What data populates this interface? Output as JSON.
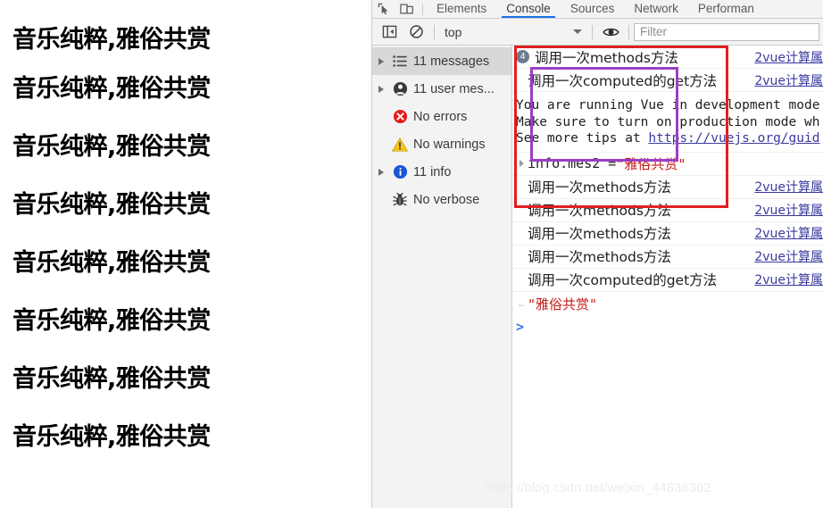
{
  "page": {
    "headings": [
      "音乐纯粹,雅俗共赏",
      "音乐纯粹,雅俗共赏",
      "音乐纯粹,雅俗共赏",
      "音乐纯粹,雅俗共赏",
      "音乐纯粹,雅俗共赏",
      "音乐纯粹,雅俗共赏",
      "音乐纯粹,雅俗共赏",
      "音乐纯粹,雅俗共赏"
    ]
  },
  "devtools": {
    "tabs": [
      {
        "label": "Elements",
        "active": false
      },
      {
        "label": "Console",
        "active": true
      },
      {
        "label": "Sources",
        "active": false
      },
      {
        "label": "Network",
        "active": false
      },
      {
        "label": "Performan",
        "active": false
      }
    ],
    "toolbar_icons": [
      {
        "name": "inspect-element-icon"
      },
      {
        "name": "device-toolbar-icon"
      }
    ],
    "filterbar": {
      "sidebar_toggle_icon": "show-console-sidebar-icon",
      "clear_console_icon": "clear-console-icon",
      "context": "top",
      "live_expression_icon": "eye-icon",
      "filter_placeholder": "Filter",
      "filter_value": ""
    },
    "sidebar": {
      "items": [
        {
          "label": "11 messages",
          "icon": "list-icon",
          "expandable": true,
          "selected": true
        },
        {
          "label": "11 user mes...",
          "icon": "user-icon",
          "expandable": true,
          "selected": false
        },
        {
          "label": "No errors",
          "icon": "error-icon",
          "expandable": false,
          "selected": false
        },
        {
          "label": "No warnings",
          "icon": "warning-icon",
          "expandable": false,
          "selected": false
        },
        {
          "label": "11 info",
          "icon": "info-icon",
          "expandable": true,
          "selected": false
        },
        {
          "label": "No verbose",
          "icon": "bug-icon",
          "expandable": false,
          "selected": false
        }
      ]
    },
    "messages": {
      "top_rows": [
        {
          "badge": "4",
          "text": "调用一次methods方法",
          "source": "2vue计算属"
        },
        {
          "badge": "",
          "text": "调用一次computed的get方法",
          "source": "2vue计算属"
        }
      ],
      "vue_warning": {
        "line1": "You are running Vue in development mode",
        "line2": "Make sure to turn on production mode wh",
        "line3_prefix": "See more tips at ",
        "line3_link": "https://vuejs.org/guid"
      },
      "evaluated": {
        "expression_code": "info.mes2 = ",
        "expression_value": "\"雅俗共赏\""
      },
      "logged_rows": [
        {
          "text": "调用一次methods方法",
          "source": "2vue计算属"
        },
        {
          "text": "调用一次methods方法",
          "source": "2vue计算属"
        },
        {
          "text": "调用一次methods方法",
          "source": "2vue计算属"
        },
        {
          "text": "调用一次methods方法",
          "source": "2vue计算属"
        },
        {
          "text": "调用一次computed的get方法",
          "source": "2vue计算属"
        }
      ],
      "return_value": "\"雅俗共赏\"",
      "prompt_caret": ">"
    },
    "annotations": {
      "red_box_color": "#e02020",
      "purple_box_color": "#9b3fc4"
    }
  },
  "watermark": "https://blog.csdn.net/weixin_44836362"
}
